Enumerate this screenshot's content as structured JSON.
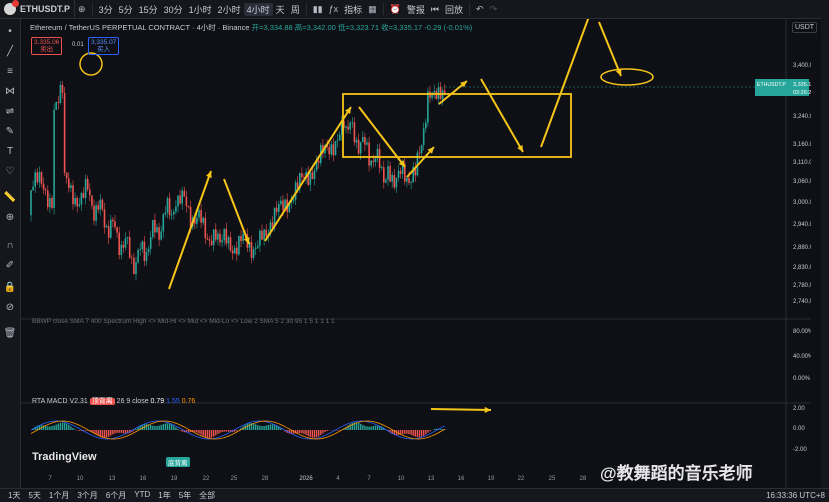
{
  "topbar": {
    "symbol": "ETHUSDT.P",
    "timeframes": [
      "3分",
      "5分",
      "15分",
      "30分",
      "1小时",
      "2小时",
      "4小时",
      "天",
      "周"
    ],
    "active_timeframe": "4小时",
    "indicators_label": "指标",
    "alert_label": "警报",
    "replay_label": "回放"
  },
  "legend": {
    "title": "Ethereum / TetherUS PERPETUAL CONTRACT · 4小时 · Binance",
    "open": "开=3,334.88",
    "high": "高=3,342.00",
    "low": "低=3,323.71",
    "close": "收=3,335.17",
    "change": "-0.29 (-0.01%)",
    "sell_price": "3,335.06",
    "sell_label": "卖出",
    "spread": "0.01",
    "buy_price": "3,335.07",
    "buy_label": "买入"
  },
  "currency": "USDT",
  "price_axis": [
    "3,400.00",
    "3,240.00",
    "3,160.00",
    "3,110.00",
    "3,060.00",
    "3,000.00",
    "2,940.00",
    "2,880.00",
    "2,830.00",
    "2,780.00",
    "2,740.00"
  ],
  "price_tag": {
    "symbol": "ETHUSDT.P",
    "price": "3,335.17",
    "countdown": "03:26:24"
  },
  "pct_axis": [
    "80.00%",
    "40.00%",
    "0.00%"
  ],
  "macd_axis": [
    "2.00",
    "0.00",
    "-2.00"
  ],
  "date_axis": [
    "7",
    "10",
    "13",
    "16",
    "19",
    "22",
    "25",
    "28",
    "2026",
    "4",
    "7",
    "10",
    "13",
    "16",
    "19",
    "22",
    "25",
    "28"
  ],
  "indicator_line": "BBWP close SMA 7 400 Spectrum High <> Mid-Hi <> Mid <> Mid-Lo <> Low 2 SMA 5 2 30 95 1 5 1 1 1 1",
  "macd": {
    "label": "RTA MACD V2.31",
    "params": "26 9 close",
    "v1": "0.79",
    "v2": "1.55",
    "v3": "0.76",
    "badge": "顶背离",
    "badge2": "底背离"
  },
  "tv_logo": "TradingView",
  "watermark": "@教舞蹈的音乐老师",
  "bottom": {
    "ranges": [
      "1天",
      "5天",
      "1个月",
      "3个月",
      "6个月",
      "YTD",
      "1年",
      "5年",
      "全部"
    ],
    "time": "16:33:36 UTC+8"
  },
  "colors": {
    "up": "#26a69a",
    "down": "#ef5350",
    "annotation": "#f5c518",
    "background": "#0e1015"
  }
}
